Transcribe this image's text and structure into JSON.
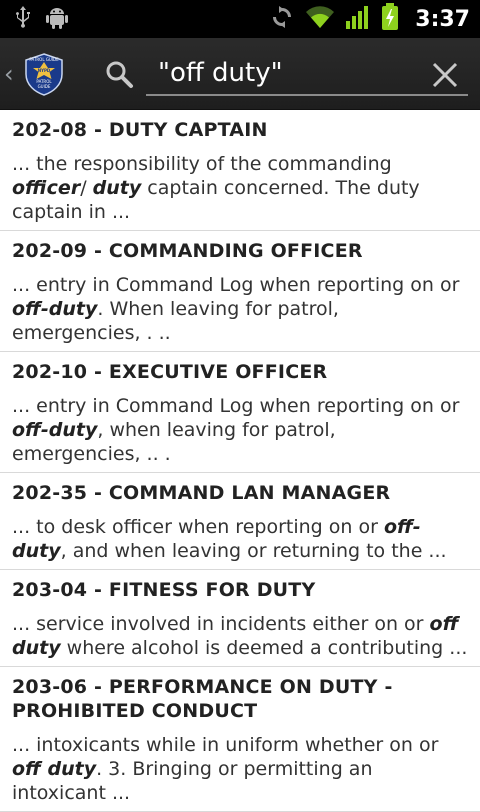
{
  "status_bar": {
    "icons": [
      "usb-icon",
      "android-debug-icon",
      "sync-icon",
      "wifi-icon",
      "signal-icon",
      "battery-charging-icon"
    ],
    "time": "3:37"
  },
  "action_bar": {
    "logo_text": [
      "PATROL GUIDE",
      "NYPD",
      "PATROL",
      "GUIDE"
    ],
    "search": {
      "value": "\"off duty\""
    }
  },
  "results": [
    {
      "title": "202-08 - DUTY CAPTAIN",
      "snippet": [
        {
          "t": "... the responsibility of the commanding "
        },
        {
          "t": "officer",
          "b": true
        },
        {
          "t": "/ "
        },
        {
          "t": "duty",
          "b": true
        },
        {
          "t": " captain concerned. The duty captain in ..."
        }
      ]
    },
    {
      "title": "202-09 - COMMANDING OFFICER",
      "snippet": [
        {
          "t": "... entry in Command Log when reporting on or "
        },
        {
          "t": "off-duty",
          "b": true
        },
        {
          "t": ". When leaving for patrol, emergencies, . .."
        }
      ]
    },
    {
      "title": "202-10 - EXECUTIVE OFFICER",
      "snippet": [
        {
          "t": "... entry in Command Log when reporting on or "
        },
        {
          "t": "off-duty",
          "b": true
        },
        {
          "t": ", when leaving for patrol, emergencies, .. ."
        }
      ]
    },
    {
      "title": "202-35 - COMMAND LAN MANAGER",
      "snippet": [
        {
          "t": "... to desk officer when reporting on or "
        },
        {
          "t": "off-duty",
          "b": true
        },
        {
          "t": ", and when leaving or returning to the ..."
        }
      ]
    },
    {
      "title": "203-04 - FITNESS FOR DUTY",
      "snippet": [
        {
          "t": "... service involved in incidents either on or "
        },
        {
          "t": "off duty",
          "b": true
        },
        {
          "t": " where alcohol is deemed a contributing ..."
        }
      ]
    },
    {
      "title": "203-06 - PERFORMANCE ON DUTY - PROHIBITED CONDUCT",
      "snippet": [
        {
          "t": "... intoxicants while in uniform whether on or "
        },
        {
          "t": "off duty",
          "b": true
        },
        {
          "t": ". 3. Bringing or permitting an intoxicant ..."
        }
      ]
    }
  ]
}
